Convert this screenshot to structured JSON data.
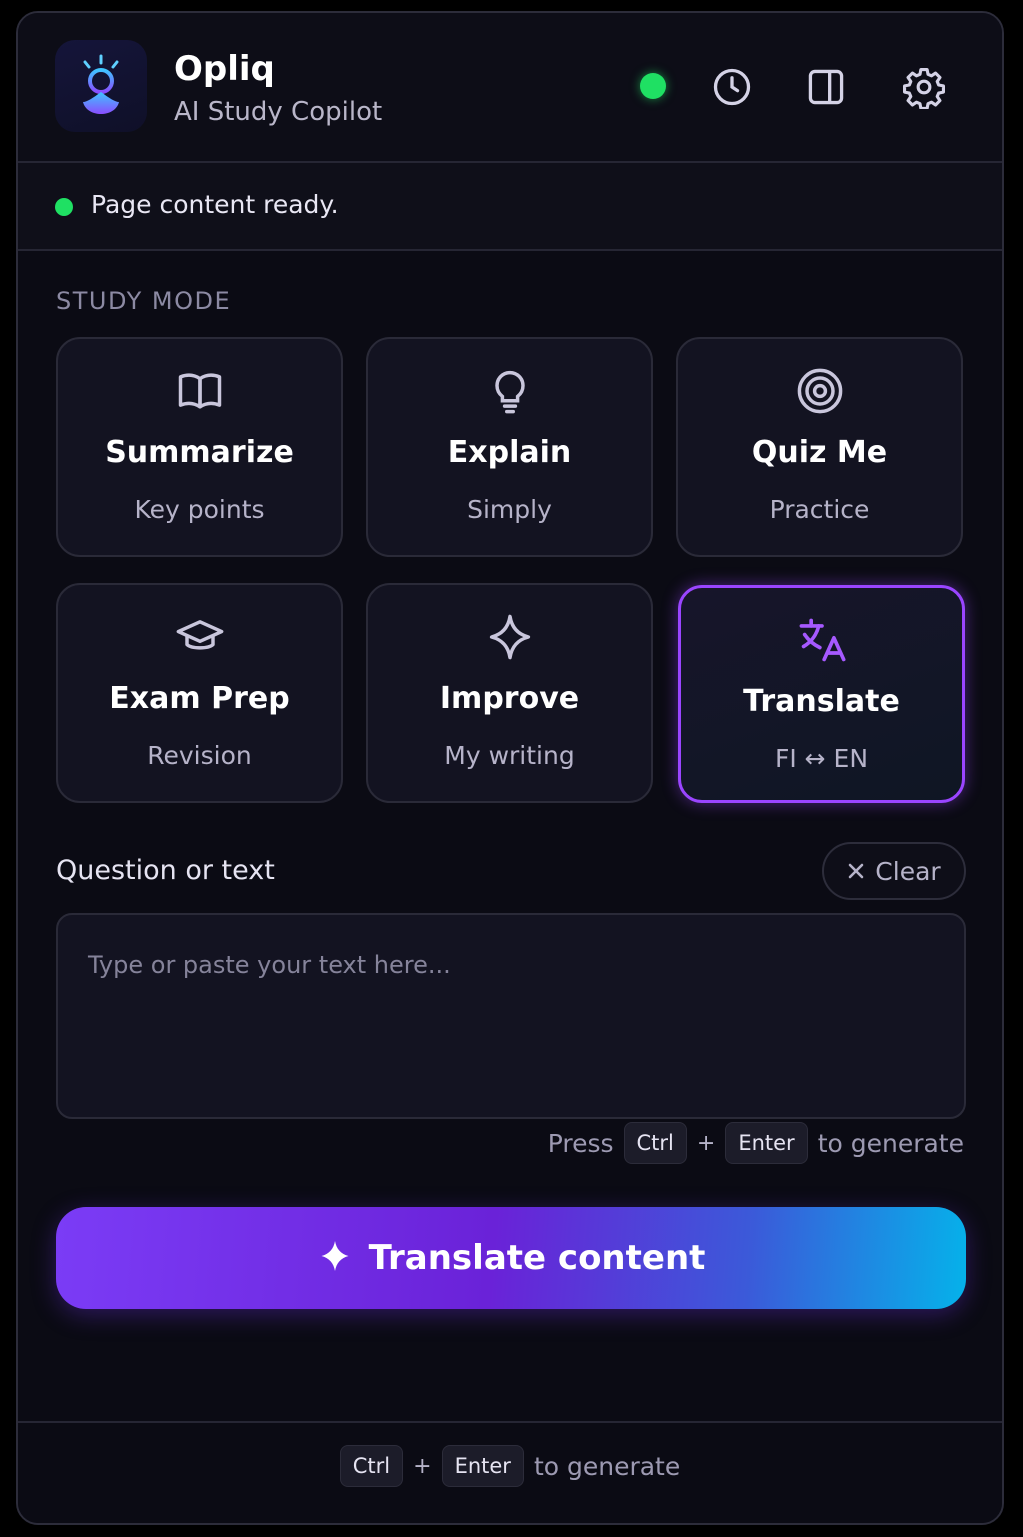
{
  "header": {
    "title": "Opliq",
    "subtitle": "AI Study Copilot",
    "icons": [
      "logo-icon",
      "status-online",
      "history-icon",
      "sidebar-panel-icon",
      "settings-gear-icon"
    ]
  },
  "status": {
    "text": "Page content ready.",
    "color": "#1fe063"
  },
  "study_mode": {
    "label": "STUDY MODE",
    "modes": [
      {
        "title": "Summarize",
        "subtitle": "Key points",
        "icon": "book-open-icon"
      },
      {
        "title": "Explain",
        "subtitle": "Simply",
        "icon": "lightbulb-icon"
      },
      {
        "title": "Quiz Me",
        "subtitle": "Practice",
        "icon": "target-icon"
      },
      {
        "title": "Exam Prep",
        "subtitle": "Revision",
        "icon": "graduation-cap-icon"
      },
      {
        "title": "Improve",
        "subtitle": "My writing",
        "icon": "sparkle-icon"
      },
      {
        "title": "Translate",
        "subtitle": "FI ↔ EN",
        "icon": "translate-icon",
        "selected": true
      }
    ]
  },
  "input": {
    "label": "Question or text",
    "clear_label": "Clear",
    "placeholder": "Type or paste your text here...",
    "value": ""
  },
  "hint": {
    "prefix": "Press",
    "key1": "Ctrl",
    "plus": "+",
    "key2": "Enter",
    "suffix": "to generate"
  },
  "primary_button": {
    "label": "Translate content"
  },
  "footer": {
    "key1": "Ctrl",
    "plus": "+",
    "key2": "Enter",
    "suffix": "to generate"
  },
  "colors": {
    "accent": "#9a45ff",
    "background": "#0b0b14",
    "status_green": "#1fe063",
    "gradient_end": "#05b2ea"
  }
}
